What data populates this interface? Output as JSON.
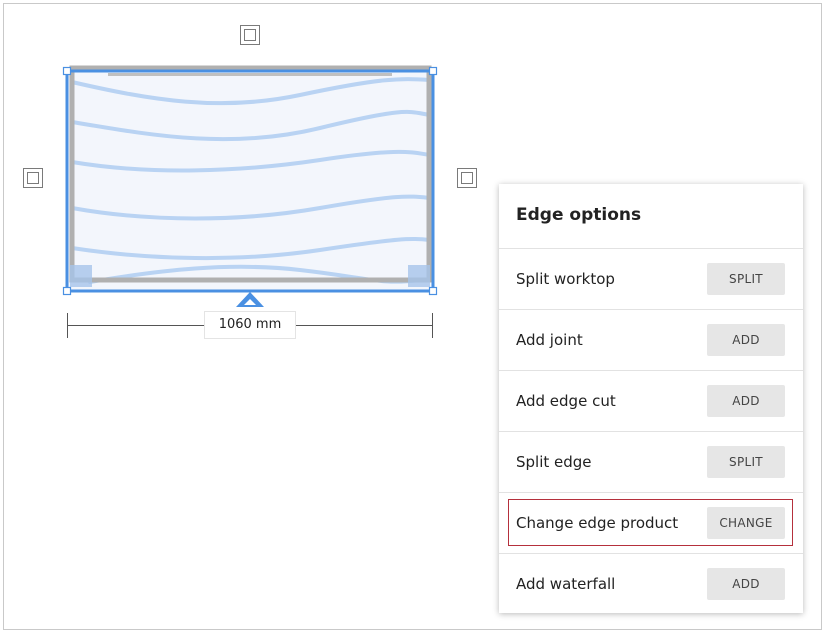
{
  "canvas": {
    "dimension_label": "1060 mm",
    "handle_icons": [
      "edge-square-icon",
      "edge-square-icon",
      "edge-square-icon"
    ],
    "colors": {
      "selection": "#4a90e2",
      "worktop_stroke": "#a9a9a9",
      "grain": "#b9d3f3"
    }
  },
  "panel": {
    "title": "Edge options",
    "rows": [
      {
        "label": "Split worktop",
        "button": "SPLIT"
      },
      {
        "label": "Add joint",
        "button": "ADD"
      },
      {
        "label": "Add edge cut",
        "button": "ADD"
      },
      {
        "label": "Split edge",
        "button": "SPLIT"
      },
      {
        "label": "Change edge product",
        "button": "CHANGE",
        "highlighted": true
      },
      {
        "label": "Add waterfall",
        "button": "ADD"
      }
    ],
    "colors": {
      "highlight_border": "#b5303c",
      "button_bg": "#e6e6e6"
    }
  }
}
